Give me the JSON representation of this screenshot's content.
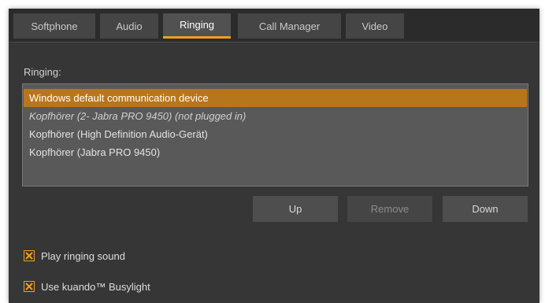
{
  "tabs": [
    {
      "label": "Softphone"
    },
    {
      "label": "Audio"
    },
    {
      "label": "Ringing"
    },
    {
      "label": "Call Manager"
    },
    {
      "label": "Video"
    }
  ],
  "active_tab": "Ringing",
  "ringing": {
    "label": "Ringing:",
    "devices": [
      {
        "label": "Windows default communication device",
        "selected": true
      },
      {
        "label": "Kopfhörer (2- Jabra PRO 9450) (not plugged in)",
        "unavailable": true
      },
      {
        "label": "Kopfhörer (High Definition Audio-Gerät)"
      },
      {
        "label": "Kopfhörer (Jabra PRO 9450)"
      }
    ]
  },
  "buttons": {
    "up": "Up",
    "remove": "Remove",
    "down": "Down"
  },
  "options": {
    "play_ringing_sound": {
      "label": "Play ringing sound",
      "checked": true
    },
    "use_busylight": {
      "label": "Use kuando™ Busylight",
      "checked": true
    }
  },
  "colors": {
    "accent": "#f0a01c",
    "selection": "#b8761c",
    "background": "#363636"
  }
}
